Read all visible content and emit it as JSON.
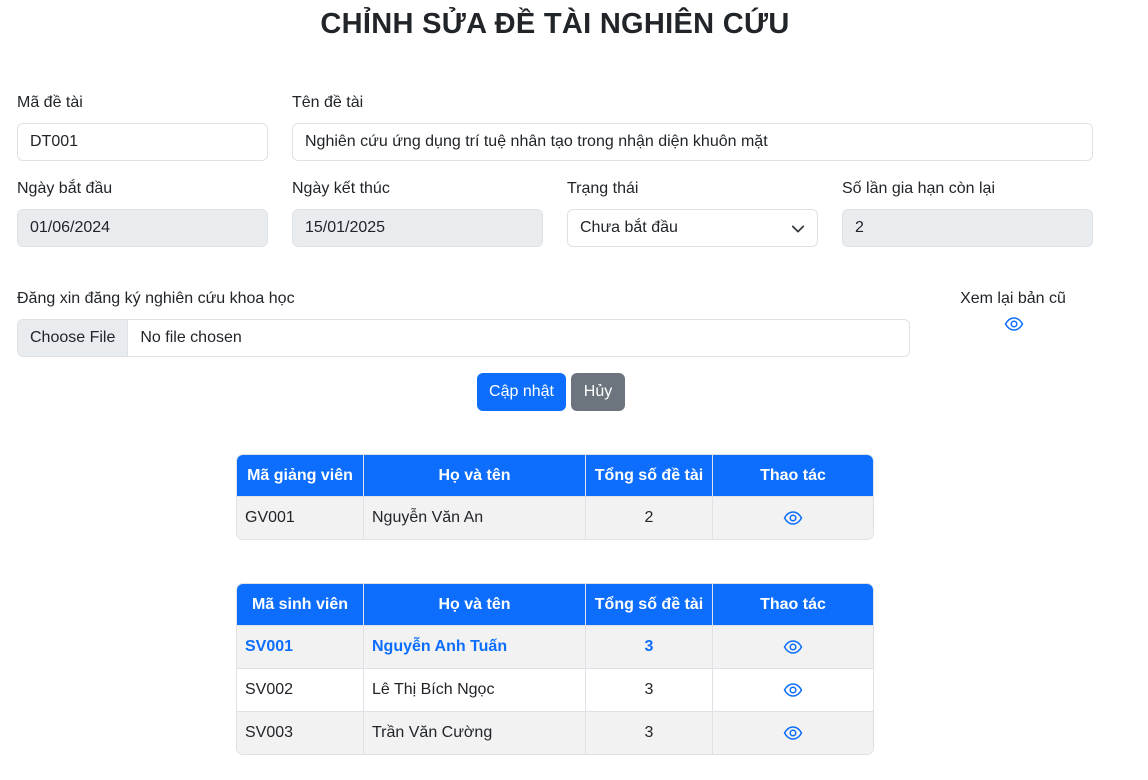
{
  "title": "CHỈNH SỬA ĐỀ TÀI NGHIÊN CỨU",
  "form": {
    "ma_de_tai": {
      "label": "Mã đề tài",
      "value": "DT001"
    },
    "ten_de_tai": {
      "label": "Tên đề tài",
      "value": "Nghiên cứu ứng dụng trí tuệ nhân tạo trong nhận diện khuôn mặt"
    },
    "ngay_bat_dau": {
      "label": "Ngày bắt đầu",
      "value": "01/06/2024"
    },
    "ngay_ket_thuc": {
      "label": "Ngày kết thúc",
      "value": "15/01/2025"
    },
    "trang_thai": {
      "label": "Trạng thái",
      "value": "Chưa bắt đầu"
    },
    "so_lan_gia_han": {
      "label": "Số lần gia hạn còn lại",
      "value": "2"
    },
    "file": {
      "label": "Đăng xin đăng ký nghiên cứu khoa học",
      "button": "Choose File",
      "status": "No file chosen"
    },
    "xem_lai": {
      "label": "Xem lại bản cũ",
      "icon": "eye-icon"
    }
  },
  "buttons": {
    "update": "Cập nhật",
    "cancel": "Hủy"
  },
  "colors": {
    "primary": "#0d6efd",
    "secondary": "#6c757d",
    "stripe": "#f2f2f2"
  },
  "lecturer_table": {
    "headers": [
      "Mã giảng viên",
      "Họ và tên",
      "Tổng số đề tài",
      "Thao tác"
    ],
    "rows": [
      {
        "id": "GV001",
        "name": "Nguyễn Văn An",
        "count": "2"
      }
    ]
  },
  "student_table": {
    "headers": [
      "Mã sinh viên",
      "Họ và tên",
      "Tổng số đề tài",
      "Thao tác"
    ],
    "rows": [
      {
        "id": "SV001",
        "name": "Nguyễn Anh Tuấn",
        "count": "3",
        "highlighted": true
      },
      {
        "id": "SV002",
        "name": "Lê Thị Bích Ngọc",
        "count": "3"
      },
      {
        "id": "SV003",
        "name": "Trần Văn Cường",
        "count": "3"
      }
    ]
  }
}
